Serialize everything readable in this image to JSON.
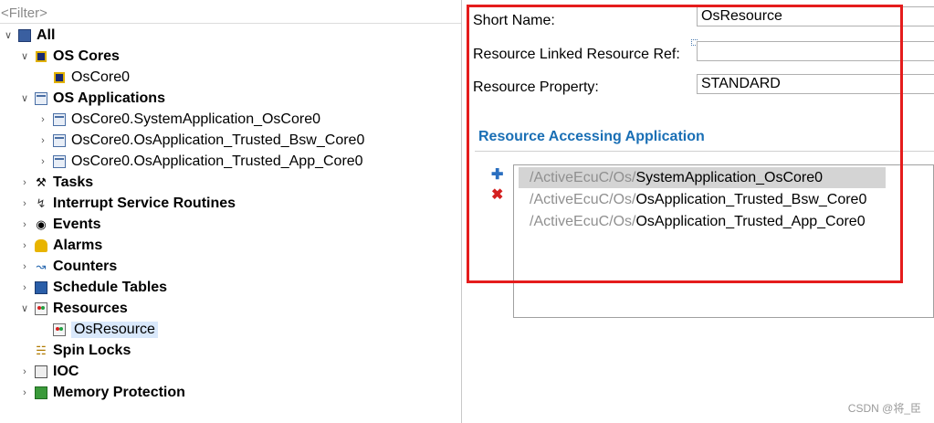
{
  "tree": {
    "filter_placeholder": "<Filter>",
    "items": [
      {
        "label": "All"
      },
      {
        "label": "OS Cores"
      },
      {
        "label": "OsCore0"
      },
      {
        "label": "OS Applications"
      },
      {
        "label": "OsCore0.SystemApplication_OsCore0"
      },
      {
        "label": "OsCore0.OsApplication_Trusted_Bsw_Core0"
      },
      {
        "label": "OsCore0.OsApplication_Trusted_App_Core0"
      },
      {
        "label": "Tasks"
      },
      {
        "label": "Interrupt Service Routines"
      },
      {
        "label": "Events"
      },
      {
        "label": "Alarms"
      },
      {
        "label": "Counters"
      },
      {
        "label": "Schedule Tables"
      },
      {
        "label": "Resources"
      },
      {
        "label": "OsResource"
      },
      {
        "label": "Spin Locks"
      },
      {
        "label": "IOC"
      },
      {
        "label": "Memory Protection"
      }
    ]
  },
  "editor": {
    "short_name_label": "Short Name:",
    "short_name_value": "OsResource",
    "linked_ref_label": "Resource Linked Resource Ref:",
    "linked_ref_value": "",
    "property_label": "Resource Property:",
    "property_value": "STANDARD",
    "section_title": "Resource Accessing Application",
    "apps": [
      {
        "prefix": "/ActiveEcuC/Os/",
        "name": "SystemApplication_OsCore0"
      },
      {
        "prefix": "/ActiveEcuC/Os/",
        "name": "OsApplication_Trusted_Bsw_Core0"
      },
      {
        "prefix": "/ActiveEcuC/Os/",
        "name": "OsApplication_Trusted_App_Core0"
      }
    ]
  },
  "watermark": "CSDN @将_臣",
  "colors": {
    "highlight": "#e51c1c",
    "section": "#1a6fb5"
  }
}
